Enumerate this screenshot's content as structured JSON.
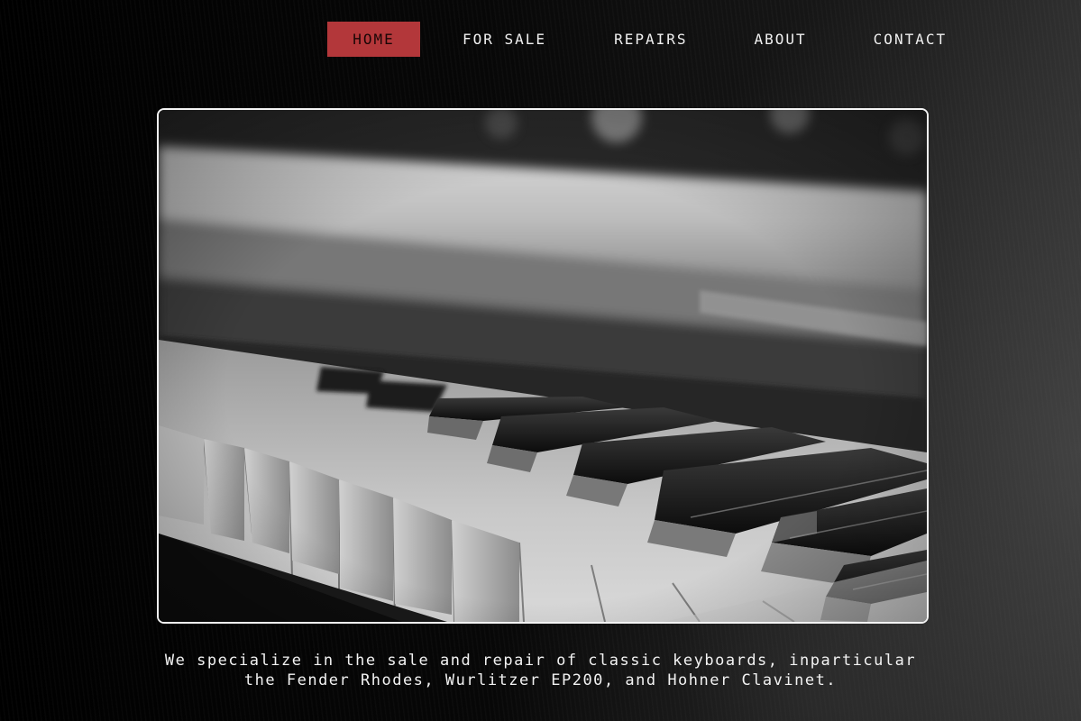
{
  "nav": {
    "items": [
      {
        "label": "HOME",
        "active": true
      },
      {
        "label": "FOR SALE",
        "active": false
      },
      {
        "label": "REPAIRS",
        "active": false
      },
      {
        "label": "ABOUT",
        "active": false
      },
      {
        "label": "CONTACT",
        "active": false
      }
    ],
    "active_color": "#b3373a"
  },
  "hero": {
    "image_subject": "black and white close-up of piano keys",
    "border_color": "#f4f4f4"
  },
  "tagline": {
    "line1": "We specialize in the sale and repair of classic keyboards, inparticular",
    "line2": "the Fender Rhodes, Wurlitzer EP200, and Hohner Clavinet."
  }
}
